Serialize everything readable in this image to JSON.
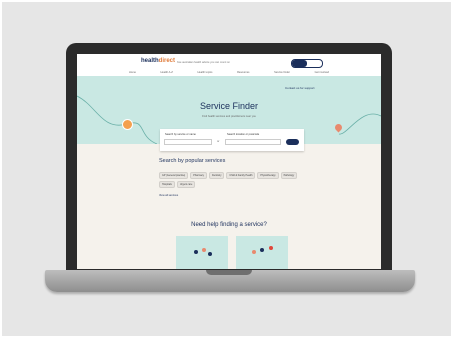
{
  "site": {
    "logo_main": "health",
    "logo_accent": "direct",
    "tagline": "free australian health advice you can count on",
    "nav": [
      "Home",
      "Health A-Z",
      "Health topics",
      "Resources",
      "Service finder",
      "Get involved"
    ],
    "support_link": "Contact us for support"
  },
  "hero": {
    "title": "Service Finder",
    "subtitle": "Find health services and practitioners near you",
    "search": {
      "service_label": "Search by service or name",
      "location_label": "Search location or postcode",
      "service_value": "",
      "location_value": "",
      "or_text": "or"
    }
  },
  "popular": {
    "heading": "Search by popular services",
    "services": [
      "GP (General practice)",
      "Pharmacy",
      "Dentistry",
      "Child & Family Health",
      "Physiotherapy",
      "Pathology",
      "Hospitals",
      "Urgent care"
    ],
    "view_all": "View all services"
  },
  "help": {
    "heading": "Need help finding a service?"
  },
  "colors": {
    "navy": "#1b2f5b",
    "teal": "#c9e8e3",
    "orange": "#f4a04f"
  }
}
